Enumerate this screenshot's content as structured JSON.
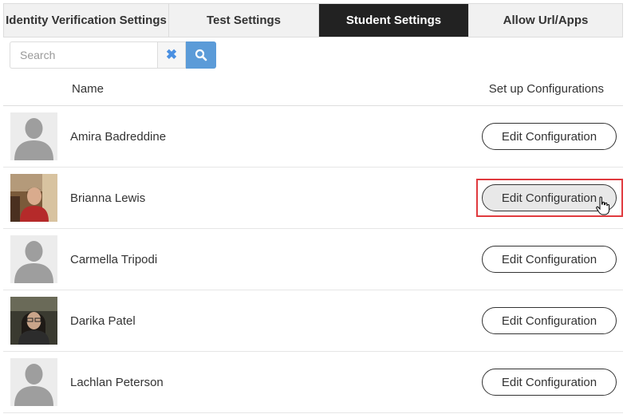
{
  "tabs": [
    {
      "label": "Identity Verification Settings",
      "active": false
    },
    {
      "label": "Test Settings",
      "active": false
    },
    {
      "label": "Student Settings",
      "active": true
    },
    {
      "label": "Allow Url/Apps",
      "active": false
    }
  ],
  "search": {
    "placeholder": "Search",
    "value": ""
  },
  "table": {
    "headers": {
      "name": "Name",
      "config": "Set up Configurations"
    },
    "rows": [
      {
        "name": "Amira Badreddine",
        "action": "Edit Configuration"
      },
      {
        "name": "Brianna Lewis",
        "action": "Edit Configuration"
      },
      {
        "name": "Carmella Tripodi",
        "action": "Edit Configuration"
      },
      {
        "name": "Darika Patel",
        "action": "Edit Configuration"
      },
      {
        "name": "Lachlan Peterson",
        "action": "Edit Configuration"
      }
    ]
  },
  "icons": {
    "clear": "close-icon",
    "search": "search-icon",
    "cursor": "hand-pointer-icon"
  },
  "colors": {
    "active_tab": "#222222",
    "search_button": "#5b9bd8",
    "highlight": "#e03a3e"
  }
}
